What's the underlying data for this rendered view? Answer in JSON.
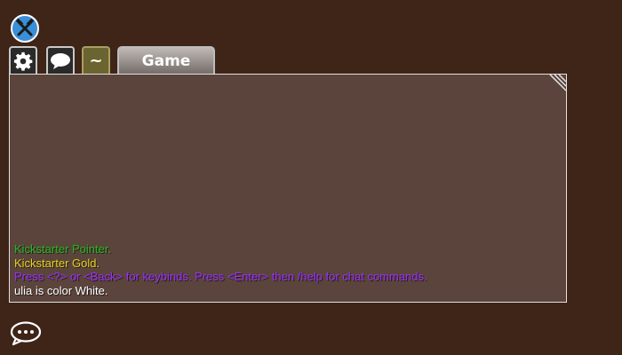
{
  "toolbar": {
    "tools_icon": "crossed-tools-icon"
  },
  "tabs": {
    "settings_icon": "gear-icon",
    "chat_icon": "speech-bubble-icon",
    "console_label": "~",
    "game_label": "Game"
  },
  "chat": {
    "lines": [
      {
        "text": "Kickstarter Pointer.",
        "color": "#22bb22"
      },
      {
        "text": "Kickstarter Gold.",
        "color": "#e6d21a"
      },
      {
        "text": "Press <?> or <Back> for keybinds. Press <Enter> then /help for chat commands.",
        "color": "#9b30ff"
      },
      {
        "text": "ulia is color White.",
        "color": "#ffffff"
      }
    ]
  },
  "chat_toggle": {
    "icon": "chat-bubble-ellipsis-icon"
  },
  "colors": {
    "background": "#3f2418",
    "panel": "#5b443b",
    "panel_border": "#e2e2e2"
  }
}
